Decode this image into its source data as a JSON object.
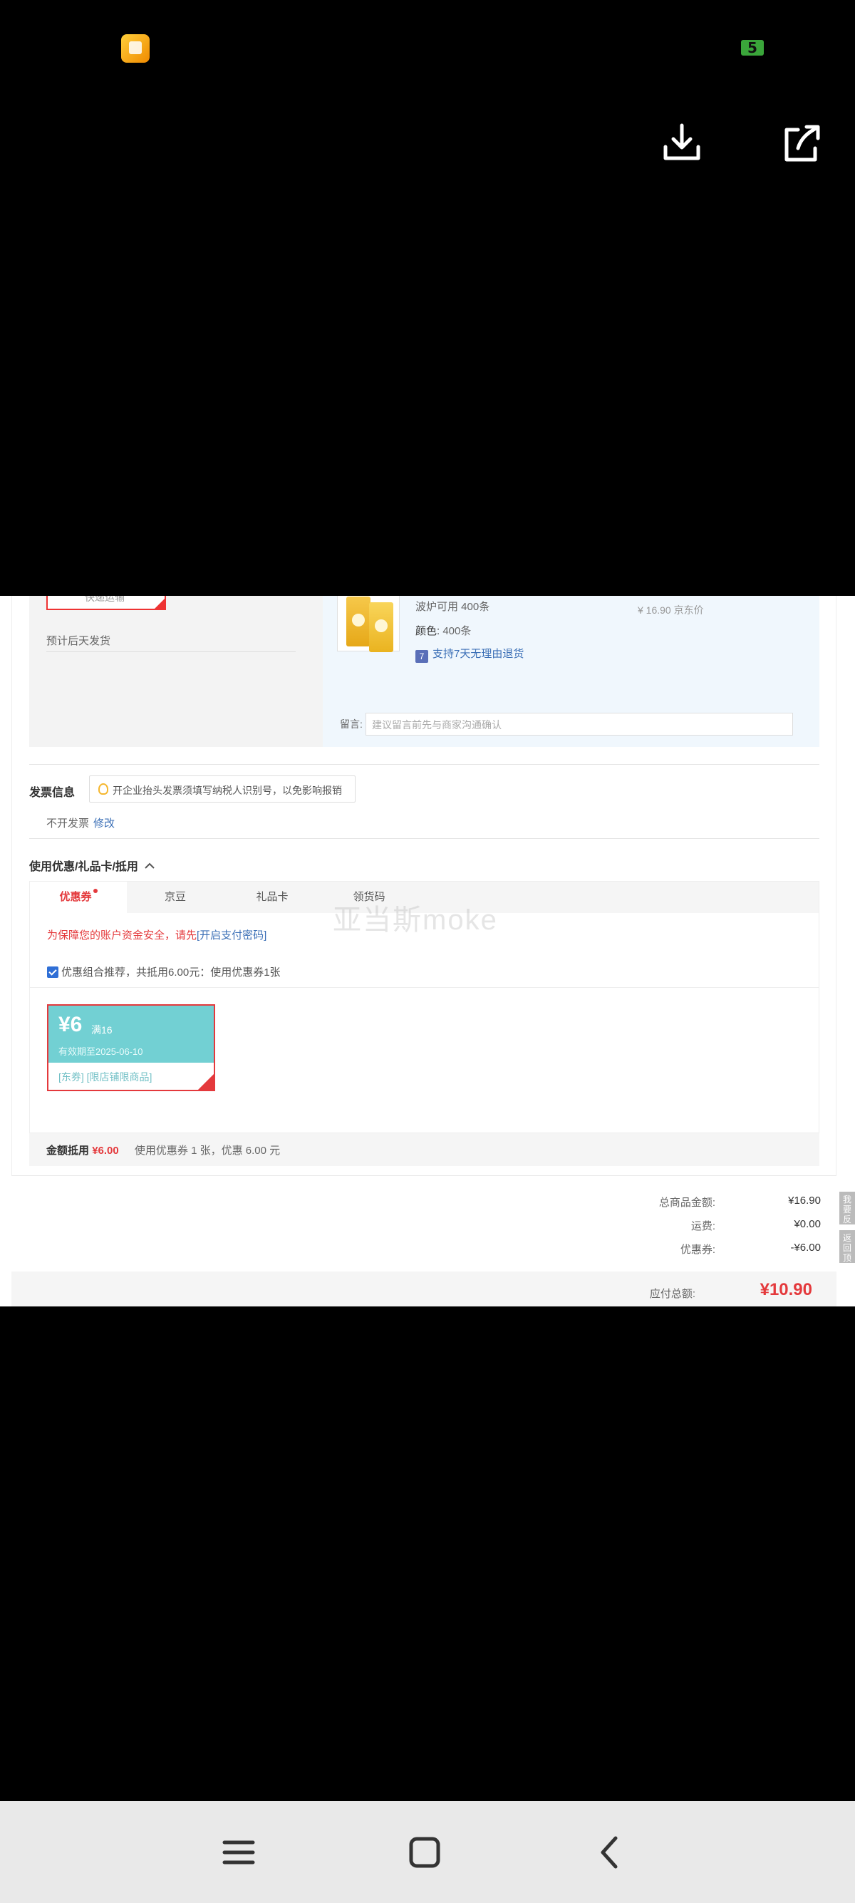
{
  "order": {
    "delivery_option": "快递运输",
    "ship_note": "预计后天发货",
    "spec_line": "波炉可用 400条",
    "color_label": "颜色:",
    "color_value": "400条",
    "return_badge": "7",
    "return_policy": "支持7天无理由退货",
    "price": "¥ 16.90 京东价",
    "memo_label": "留言:",
    "memo_placeholder": "建议留言前先与商家沟通确认"
  },
  "invoice": {
    "title": "发票信息",
    "tip": "开企业抬头发票须填写纳税人识别号，以免影响报销",
    "status": "不开发票",
    "edit": "修改"
  },
  "coupons": {
    "section_title": "使用优惠/礼品卡/抵用",
    "tabs": [
      {
        "label": "优惠券"
      },
      {
        "label": "京豆"
      },
      {
        "label": "礼品卡"
      },
      {
        "label": "领货码"
      }
    ],
    "security_text": "为保障您的账户资金安全，请先",
    "security_link": "[开启支付密码]",
    "combo_text": "优惠组合推荐，共抵用6.00元：使用优惠券1张",
    "card": {
      "amount": "¥6",
      "condition": "满16",
      "validity": "有效期至2025-06-10",
      "tags": "[东券] [限店铺限商品]"
    },
    "deduct_label": "金额抵用",
    "deduct_amount": "¥6.00",
    "deduct_note": "使用优惠券 1 张，优惠 6.00 元"
  },
  "watermark": "亚当斯moke",
  "summary": {
    "goods_label": "总商品金额:",
    "goods_value": "¥16.90",
    "shipping_label": "运费:",
    "shipping_value": "¥0.00",
    "coupon_label": "优惠券:",
    "coupon_value": "-¥6.00",
    "total_label": "应付总额:",
    "total_value": "¥10.90"
  },
  "side_tabs": {
    "feedback": "我要反馈",
    "back_top": "返回顶部"
  },
  "status_bar": {
    "badge": "5"
  },
  "colors": {
    "accent_red": "#e4393c",
    "link_blue": "#3b6fb6",
    "coupon_teal": "#72d0d3"
  }
}
